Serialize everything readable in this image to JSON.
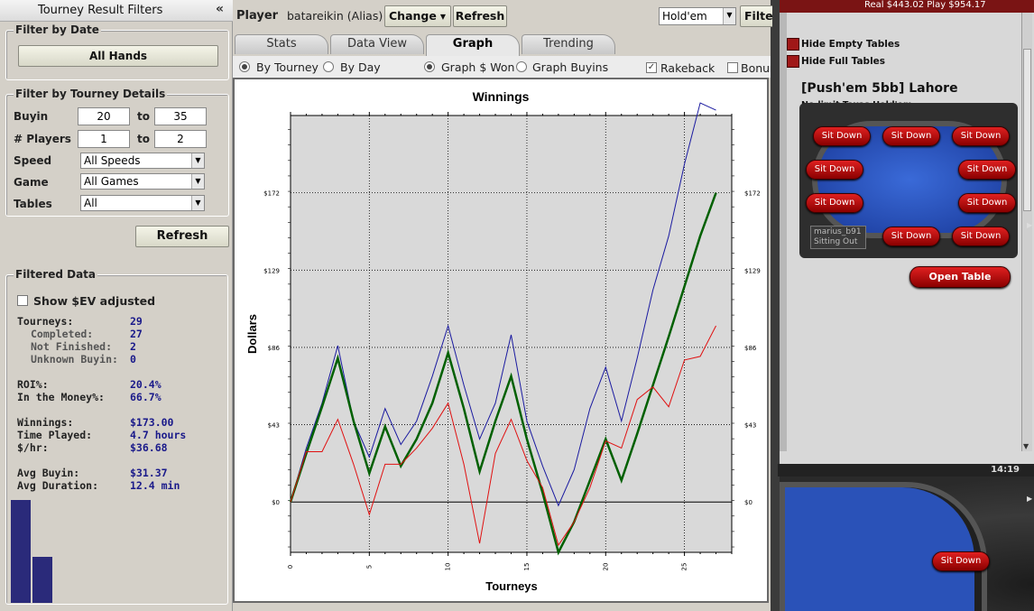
{
  "left": {
    "title": "Tourney Result Filters",
    "collapse_icon": "«",
    "date_legend": "Filter by Date",
    "all_hands_label": "All Hands",
    "details_legend": "Filter by Tourney Details",
    "buyin_label": "Buyin",
    "buyin_from": "20",
    "buyin_to": "35",
    "to_label": "to",
    "players_label": "# Players",
    "players_from": "1",
    "players_to": "2",
    "speed_label": "Speed",
    "speed_value": "All Speeds",
    "game_label": "Game",
    "game_value": "All Games",
    "tables_label": "Tables",
    "tables_value": "All",
    "refresh_label": "Refresh",
    "filtered_legend": "Filtered Data",
    "show_ev_label": "Show $EV adjusted",
    "stats": [
      {
        "label": "Tourneys:",
        "value": "29",
        "sub": false
      },
      {
        "label": "Completed:",
        "value": "27",
        "sub": true
      },
      {
        "label": "Not Finished:",
        "value": "2",
        "sub": true
      },
      {
        "label": "Unknown Buyin:",
        "value": "0",
        "sub": true
      },
      {
        "label": "ROI%:",
        "value": "20.4%",
        "sub": false
      },
      {
        "label": "In the Money%:",
        "value": "66.7%",
        "sub": false
      },
      {
        "label": "Winnings:",
        "value": "$173.00",
        "sub": false
      },
      {
        "label": "Time Played:",
        "value": "4.7 hours",
        "sub": false
      },
      {
        "label": "$/hr:",
        "value": "$36.68",
        "sub": false
      },
      {
        "label": "Avg Buyin:",
        "value": "$31.37",
        "sub": false
      },
      {
        "label": "Avg Duration:",
        "value": "12.4 min",
        "sub": false
      }
    ]
  },
  "toolbar": {
    "player_label": "Player",
    "player_name": "batareikin (Alias)",
    "change_label": "Change",
    "refresh_label": "Refresh",
    "game_select": "Hold'em",
    "filter_label": "Filte"
  },
  "tabs": [
    "Stats",
    "Data View",
    "Graph",
    "Trending"
  ],
  "options": {
    "by_tourney": "By Tourney",
    "by_day": "By Day",
    "graph_won": "Graph $ Won",
    "graph_buyins": "Graph Buyins",
    "rakeback": "Rakeback",
    "bonus": "Bonu"
  },
  "chart_data": {
    "type": "line",
    "title": "Winnings",
    "xlabel": "Tourneys",
    "ylabel": "Dollars",
    "xlim": [
      0,
      28
    ],
    "ylim": [
      -28,
      215
    ],
    "x_ticks": [
      0,
      5,
      10,
      15,
      20,
      25
    ],
    "y_ticks": [
      0,
      43,
      86,
      129,
      172
    ],
    "y_tick_labels": [
      "$0",
      "$43",
      "$86",
      "$129",
      "$172"
    ],
    "grid": true,
    "x": [
      0,
      1,
      2,
      3,
      4,
      5,
      6,
      7,
      8,
      9,
      10,
      11,
      12,
      13,
      14,
      15,
      16,
      17,
      18,
      19,
      20,
      21,
      22,
      23,
      24,
      25,
      26,
      27
    ],
    "series": [
      {
        "color": "#1a1aa0",
        "width": 1,
        "values": [
          0,
          30,
          55,
          87,
          45,
          25,
          52,
          32,
          45,
          70,
          98,
          65,
          35,
          55,
          93,
          45,
          20,
          -2,
          18,
          52,
          75,
          45,
          80,
          118,
          148,
          188,
          222,
          218
        ]
      },
      {
        "color": "#006000",
        "width": 2.5,
        "values": [
          0,
          27,
          53,
          80,
          45,
          16,
          42,
          20,
          35,
          55,
          83,
          52,
          17,
          45,
          70,
          35,
          5,
          -28,
          -11,
          12,
          35,
          12,
          38,
          65,
          92,
          120,
          148,
          172
        ]
      },
      {
        "color": "#e01010",
        "width": 1,
        "values": [
          0,
          28,
          28,
          46,
          21,
          -7,
          21,
          21,
          30,
          41,
          55,
          21,
          -23,
          27,
          46,
          23,
          8,
          -24,
          -11,
          8,
          34,
          30,
          57,
          64,
          53,
          79,
          81,
          98
        ]
      }
    ]
  },
  "right": {
    "balance": "Real $443.02  Play $954.17",
    "hide_empty": "Hide Empty Tables",
    "hide_full": "Hide Full Tables",
    "table_title": "[Push'em 5bb] Lahore",
    "table_subtitle": "No-limit Texas Hold'em",
    "sit_down": "Sit Down",
    "player_seat_name": "marius_b91",
    "player_seat_status": "Sitting Out",
    "open_table": "Open Table",
    "clock": "14:19"
  }
}
